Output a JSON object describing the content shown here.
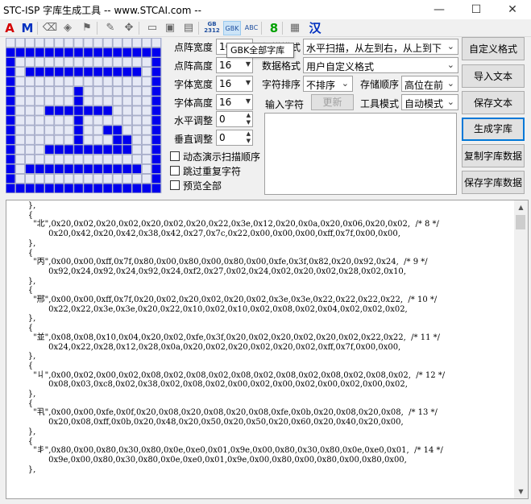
{
  "window": {
    "title": "STC-ISP 字库生成工具 -- www.STCAI.com --",
    "minimize": "—",
    "maximize": "☐",
    "close": "✕"
  },
  "toolbar": {
    "items": [
      {
        "name": "font-color-a",
        "glyph": "A",
        "color": "#d40000"
      },
      {
        "name": "font-color-m",
        "glyph": "M",
        "color": "#0030c0"
      },
      {
        "name": "eraser",
        "glyph": "⌫"
      },
      {
        "name": "fill",
        "glyph": "◈"
      },
      {
        "name": "stamp",
        "glyph": "⚑"
      },
      {
        "name": "pencil",
        "glyph": "✎"
      },
      {
        "name": "move",
        "glyph": "✥"
      },
      {
        "name": "open",
        "glyph": "▭"
      },
      {
        "name": "save",
        "glyph": "▣"
      },
      {
        "name": "save-as",
        "glyph": "▤"
      },
      {
        "name": "gb2312",
        "glyph": "GB\n2312"
      },
      {
        "name": "gbk",
        "glyph": "GBK"
      },
      {
        "name": "abc",
        "glyph": "ABC"
      },
      {
        "name": "digit-8",
        "glyph": "8",
        "color": "#00a000"
      },
      {
        "name": "palette",
        "glyph": "▦"
      },
      {
        "name": "hanzi",
        "glyph": "汉",
        "color": "#0030c0"
      }
    ]
  },
  "tooltip": "GBK全部字库",
  "grid": {
    "on_color": "#0000ee",
    "off_color": "#e6e9f5",
    "line_color": "#8e95b8",
    "rows": [
      "0000000000000000",
      "1111111111111111",
      "1000000000000001",
      "1011111111111101",
      "1000000000000001",
      "1000000100000001",
      "1000000100000001",
      "1000111111100001",
      "1000000100000001",
      "1000000100110001",
      "1000000100011001",
      "1000111111111001",
      "1000000000000001",
      "1011111111111101",
      "1000000000000001",
      "1111111111111111"
    ]
  },
  "settings": {
    "dot_width_label": "点阵宽度",
    "dot_width_value": "16",
    "dot_height_label": "点阵高度",
    "dot_height_value": "16",
    "font_width_label": "字体宽度",
    "font_width_value": "16",
    "font_height_label": "字体高度",
    "font_height_value": "16",
    "h_adjust_label": "水平调整",
    "h_adjust_value": "0",
    "v_adjust_label": "垂直调整",
    "v_adjust_value": "0",
    "scan_mode_label": "扫描模式",
    "scan_mode_value": "水平扫描，从左到右，从上到下",
    "data_format_label": "数据格式",
    "data_format_value": "用户自定义格式",
    "char_sort_label": "字符排序",
    "char_sort_value": "不排序",
    "storage_order_label": "存储顺序",
    "storage_order_value": "高位在前",
    "input_char_label": "输入字符",
    "update_button": "更新",
    "tool_mode_label": "工具模式",
    "tool_mode_value": "自动模式"
  },
  "checkboxes": [
    {
      "label": "动态演示扫描顺序",
      "checked": false
    },
    {
      "label": "跳过重复字符",
      "checked": false
    },
    {
      "label": "预览全部",
      "checked": false
    }
  ],
  "buttons": {
    "custom_format": "自定义格式",
    "import_text": "导入文本",
    "save_text": "保存文本",
    "generate": "生成字库",
    "copy_data": "复制字库数据",
    "save_data": "保存字库数据"
  },
  "output_lines": [
    "    },",
    "    {",
    "      \"北\",0x20,0x02,0x20,0x02,0x20,0x02,0x20,0x22,0x3e,0x12,0x20,0x0a,0x20,0x06,0x20,0x02,  /* 8 */",
    "            0x20,0x42,0x20,0x42,0x38,0x42,0x27,0x7c,0x22,0x00,0x00,0x00,0xff,0x7f,0x00,0x00,",
    "    },",
    "    {",
    "      \"丙\",0x00,0x00,0xff,0x7f,0x80,0x00,0x80,0x00,0x80,0x00,0xfe,0x3f,0x82,0x20,0x92,0x24,  /* 9 */",
    "            0x92,0x24,0x92,0x24,0x92,0x24,0xf2,0x27,0x02,0x24,0x02,0x20,0x02,0x28,0x02,0x10,",
    "    },",
    "    {",
    "      \"邢\",0x00,0x00,0xff,0x7f,0x20,0x02,0x20,0x02,0x20,0x02,0x3e,0x3e,0x22,0x22,0x22,0x22,  /* 10 */",
    "            0x22,0x22,0x3e,0x3e,0x20,0x22,0x10,0x02,0x10,0x02,0x08,0x02,0x04,0x02,0x02,0x02,",
    "    },",
    "    {",
    "      \"並\",0x08,0x08,0x10,0x04,0x20,0x02,0xfe,0x3f,0x20,0x02,0x20,0x02,0x20,0x02,0x22,0x22,  /* 11 */",
    "            0x24,0x22,0x28,0x12,0x28,0x0a,0x20,0x02,0x20,0x02,0x20,0x02,0xff,0x7f,0x00,0x00,",
    "    },",
    "    {",
    "      \"丩\",0x00,0x02,0x00,0x02,0x08,0x02,0x08,0x02,0x08,0x02,0x08,0x02,0x08,0x02,0x08,0x02,  /* 12 */",
    "            0x08,0x03,0xc8,0x02,0x38,0x02,0x08,0x02,0x00,0x02,0x00,0x02,0x00,0x02,0x00,0x02,",
    "    },",
    "    {",
    "      \"丮\",0x00,0x00,0xfe,0x0f,0x20,0x08,0x20,0x08,0x20,0x08,0xfe,0x0b,0x20,0x08,0x20,0x08,  /* 13 */",
    "            0x20,0x08,0xff,0x0b,0x20,0x48,0x20,0x50,0x20,0x50,0x20,0x60,0x20,0x40,0x20,0x00,",
    "    },",
    "    {",
    "      \"丯\",0x80,0x00,0x80,0x30,0x80,0x0e,0xe0,0x01,0x9e,0x00,0x80,0x30,0x80,0x0e,0xe0,0x01,  /* 14 */",
    "            0x9e,0x00,0x80,0x30,0x80,0x0e,0xe0,0x01,0x9e,0x00,0x80,0x00,0x80,0x00,0x80,0x00,",
    "    },"
  ],
  "scrollbar": {
    "up": "▲",
    "down": "▼"
  }
}
